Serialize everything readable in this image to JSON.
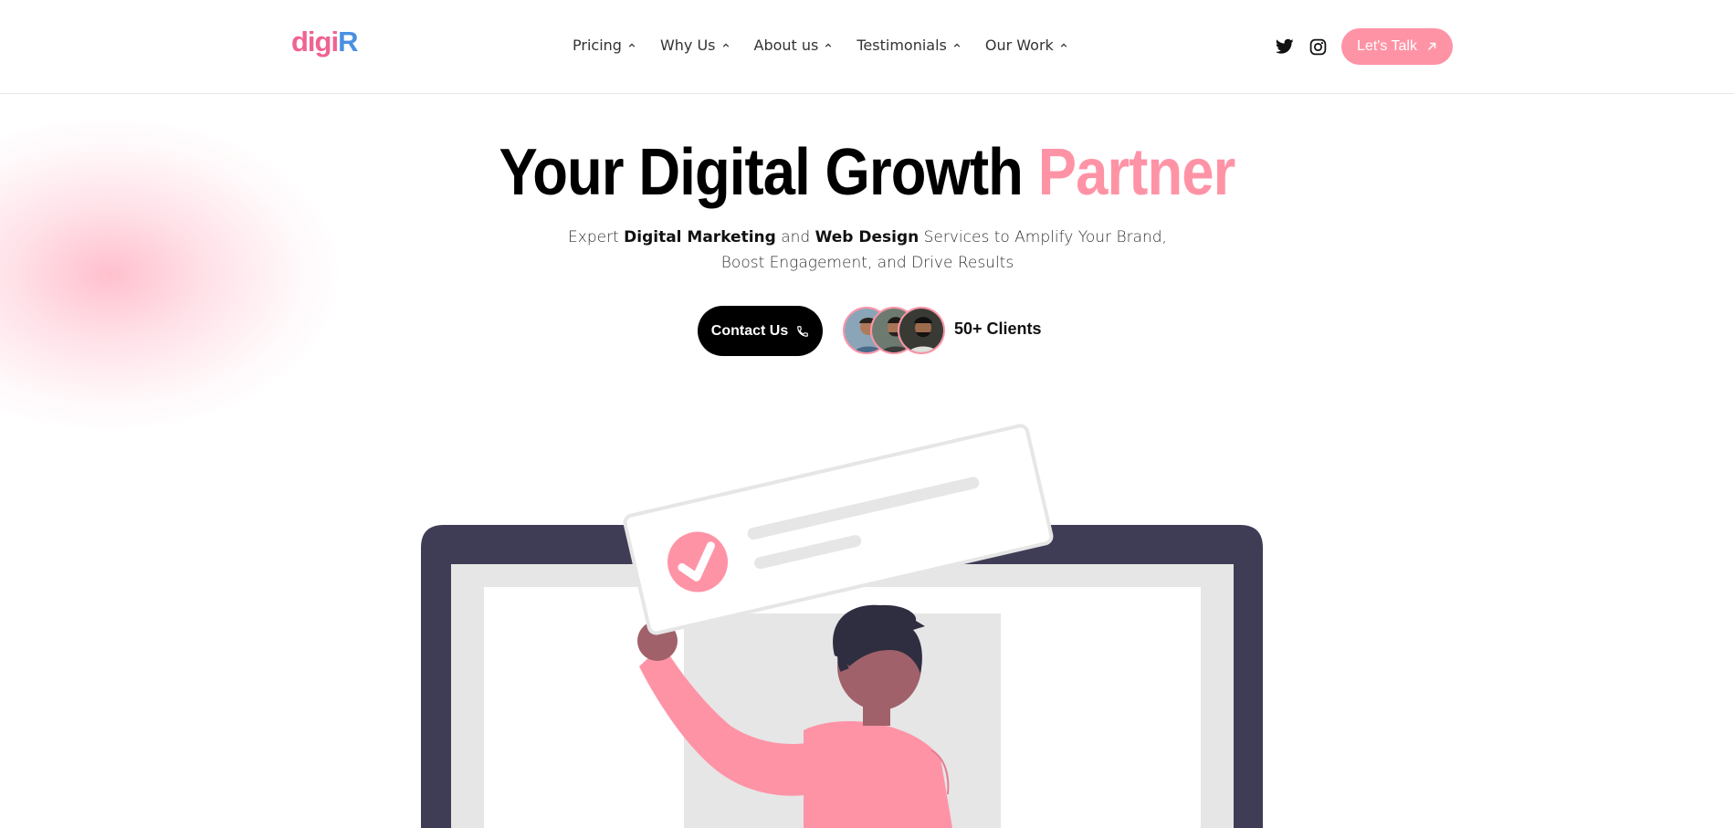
{
  "brand": {
    "logo_main": "digi",
    "logo_end": "R",
    "pink": "#ff93a6",
    "blue": "#4a90e2"
  },
  "nav": {
    "items": [
      {
        "label": "Pricing"
      },
      {
        "label": "Why Us"
      },
      {
        "label": "About us"
      },
      {
        "label": "Testimonials"
      },
      {
        "label": "Our Work"
      }
    ],
    "chevron_icon": "chevron-up-icon"
  },
  "socials": {
    "twitter_icon": "twitter-icon",
    "instagram_icon": "instagram-icon"
  },
  "header_cta": {
    "label": "Let's Talk",
    "icon": "arrow-up-right-icon"
  },
  "hero": {
    "title_main": "Your Digital Growth ",
    "title_accent": "Partner",
    "sub_1": "Expert ",
    "sub_2": "Digital Marketing",
    "sub_3": " and ",
    "sub_4": "Web Design",
    "sub_5": " Services to Amplify Your Brand,",
    "sub_6": "Boost Engagement, and Drive Results",
    "contact_label": "Contact Us",
    "contact_icon": "phone-icon",
    "clients_label": "50+ Clients"
  },
  "colors": {
    "laptop_frame": "#3f3d56",
    "screen": "#e6e6e6",
    "shirt": "#ff93a6",
    "skin": "#a0616a",
    "hair": "#2f2e41"
  }
}
